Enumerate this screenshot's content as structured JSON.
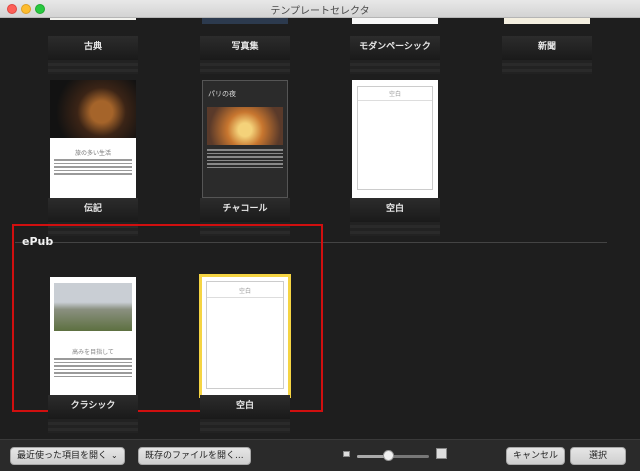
{
  "window": {
    "title": "テンプレートセレクタ"
  },
  "templates_row1": [
    "古典",
    "写真集",
    "モダンペーシック",
    "新聞"
  ],
  "templates_row2": {
    "biography": {
      "label": "伝記",
      "page_heading": "旅の多い生活"
    },
    "charcoal": {
      "label": "チャコール",
      "page_heading": "パリの夜"
    },
    "blank": {
      "label": "空白",
      "page_heading": "空白"
    }
  },
  "epub": {
    "section_title": "ePub",
    "classic": {
      "label": "クラシック",
      "page_heading": "高みを目指して"
    },
    "blank": {
      "label": "空白",
      "page_heading": "空白"
    }
  },
  "toolbar": {
    "recent_label": "最近使った項目を開く",
    "open_existing_label": "既存のファイルを開く...",
    "zoom_level": 0.45,
    "cancel_label": "キャンセル",
    "choose_label": "選択"
  },
  "colors": {
    "selection": "#f5d443",
    "highlight_box": "#d10f0f"
  }
}
